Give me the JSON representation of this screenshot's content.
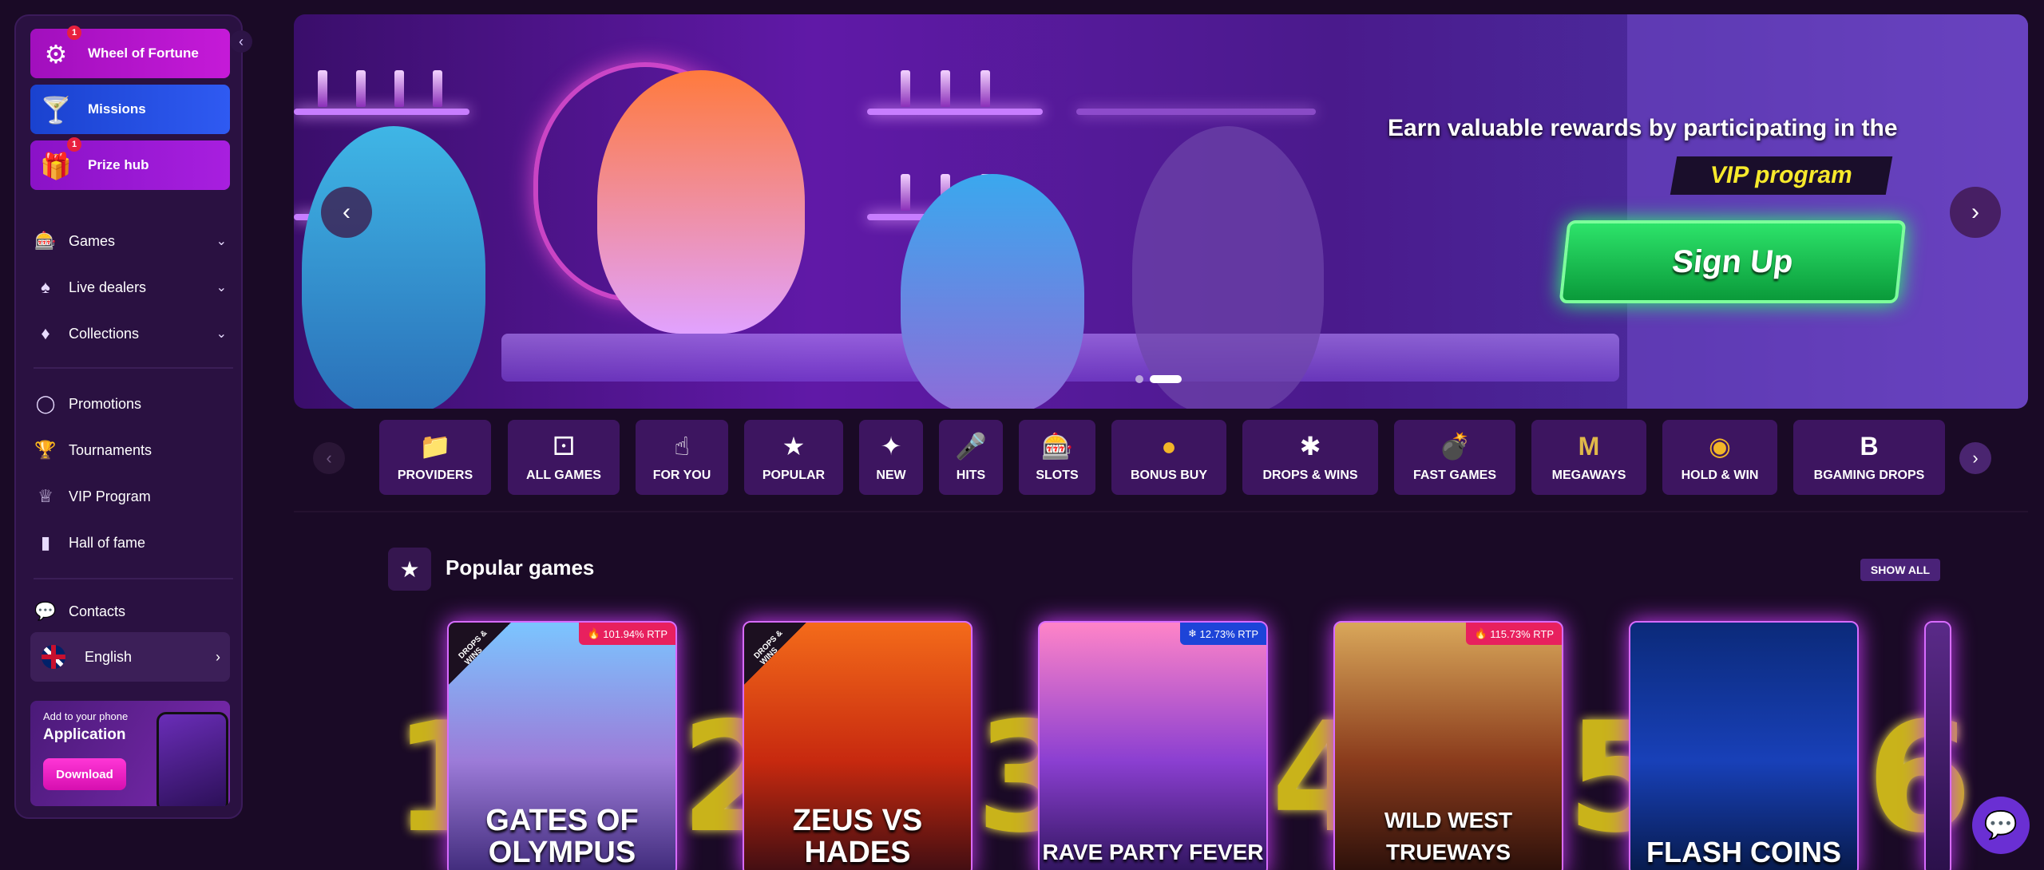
{
  "sidebar": {
    "promos": [
      {
        "label": "Wheel of Fortune",
        "icon": "wheel-icon",
        "badge": "1"
      },
      {
        "label": "Missions",
        "icon": "cocktail-icon"
      },
      {
        "label": "Prize hub",
        "icon": "treasure-chest-icon",
        "badge": "1"
      }
    ],
    "nav_group_1": [
      {
        "label": "Games",
        "icon": "slot-machine-icon"
      },
      {
        "label": "Live dealers",
        "icon": "dealer-icon"
      },
      {
        "label": "Collections",
        "icon": "cards-icon"
      }
    ],
    "nav_group_2": [
      {
        "label": "Promotions",
        "icon": "gift-icon"
      },
      {
        "label": "Tournaments",
        "icon": "trophy-icon"
      },
      {
        "label": "VIP Program",
        "icon": "crown-icon"
      },
      {
        "label": "Hall of fame",
        "icon": "podium-icon"
      }
    ],
    "contacts": {
      "label": "Contacts",
      "icon": "chat-icon"
    },
    "language": {
      "label": "English"
    },
    "app": {
      "small": "Add to your phone",
      "big": "Application",
      "button": "Download"
    }
  },
  "banner": {
    "headline": "Earn valuable rewards by participating in the",
    "highlight": "VIP program",
    "cta": "Sign Up",
    "slides": 2,
    "active_slide": 2
  },
  "categories": [
    {
      "label": "PROVIDERS",
      "icon": "folder-icon"
    },
    {
      "label": "ALL GAMES",
      "icon": "dice-icon"
    },
    {
      "label": "FOR YOU",
      "icon": "pointing-hand-icon"
    },
    {
      "label": "POPULAR",
      "icon": "star-icon"
    },
    {
      "label": "NEW",
      "icon": "sparkle-icon"
    },
    {
      "label": "HITS",
      "icon": "microphone-icon"
    },
    {
      "label": "SLOTS",
      "icon": "slot-icon"
    },
    {
      "label": "BONUS BUY",
      "icon": "coin-icon"
    },
    {
      "label": "DROPS & WINS",
      "icon": "drops-wins-icon"
    },
    {
      "label": "FAST GAMES",
      "icon": "bomb-icon"
    },
    {
      "label": "MEGAWAYS",
      "icon": "megaways-icon"
    },
    {
      "label": "HOLD & WIN",
      "icon": "pot-icon"
    },
    {
      "label": "BGAMING DROPS",
      "icon": "bgaming-icon"
    }
  ],
  "popular": {
    "title": "Popular games",
    "show_all": "SHOW ALL",
    "games": [
      {
        "rank": "1",
        "name": "GATES OF OLYMPUS",
        "rtp": "101.94% RTP",
        "rtp_kind": "hot",
        "drops_wins": true
      },
      {
        "rank": "2",
        "name": "ZEUS VS HADES",
        "rtp": "",
        "rtp_kind": "",
        "drops_wins": true
      },
      {
        "rank": "3",
        "name": "RAVE PARTY FEVER",
        "rtp": "12.73% RTP",
        "rtp_kind": "cold",
        "drops_wins": false
      },
      {
        "rank": "4",
        "name": "WILD WEST TRUEWAYS",
        "rtp": "115.73% RTP",
        "rtp_kind": "hot",
        "drops_wins": false
      },
      {
        "rank": "5",
        "name": "FLASH COINS",
        "rtp": "",
        "rtp_kind": "",
        "drops_wins": false
      },
      {
        "rank": "6",
        "name": "",
        "rtp": "",
        "rtp_kind": "",
        "drops_wins": false
      }
    ],
    "drops_wins_label": "DROPS & WINS"
  },
  "colors": {
    "background": "#1a0a26",
    "sidebar": "#2a1141",
    "cta_green": "#2de36a",
    "vip_yellow": "#f7e92c",
    "rtp_hot": "#e8205e",
    "rtp_cold": "#1d44d8",
    "card_glow": "#d86bff"
  }
}
